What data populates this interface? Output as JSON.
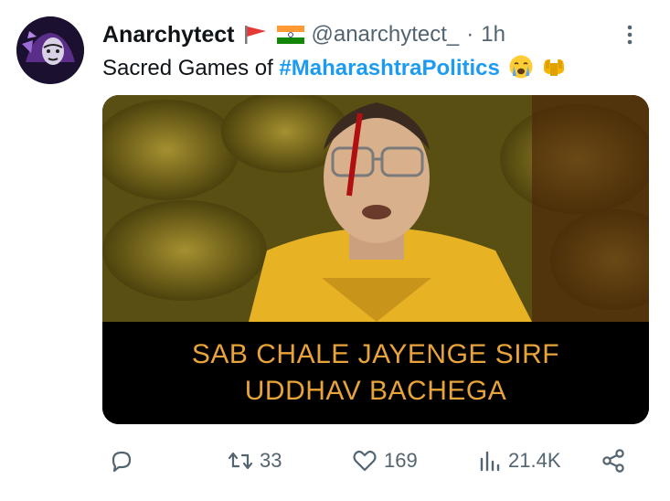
{
  "tweet": {
    "display_name": "Anarchytect",
    "handle": "@anarchytect_",
    "separator": "·",
    "time": "1h",
    "text_prefix": "Sacred Games of ",
    "hashtag": "#MaharashtraPolitics",
    "emojis": [
      "crying-face-icon",
      "palms-up-together-icon"
    ],
    "flags": [
      "red-flag-icon",
      "india-flag-icon"
    ]
  },
  "media": {
    "caption_line1": "SAB CHALE JAYENGE SIRF",
    "caption_line2": "UDDHAV BACHEGA"
  },
  "actions": {
    "reply_count": "",
    "retweet_count": "33",
    "like_count": "169",
    "views_count": "21.4K"
  },
  "colors": {
    "accent": "#1d9bf0",
    "muted": "#536471",
    "caption": "#e8a33a"
  }
}
